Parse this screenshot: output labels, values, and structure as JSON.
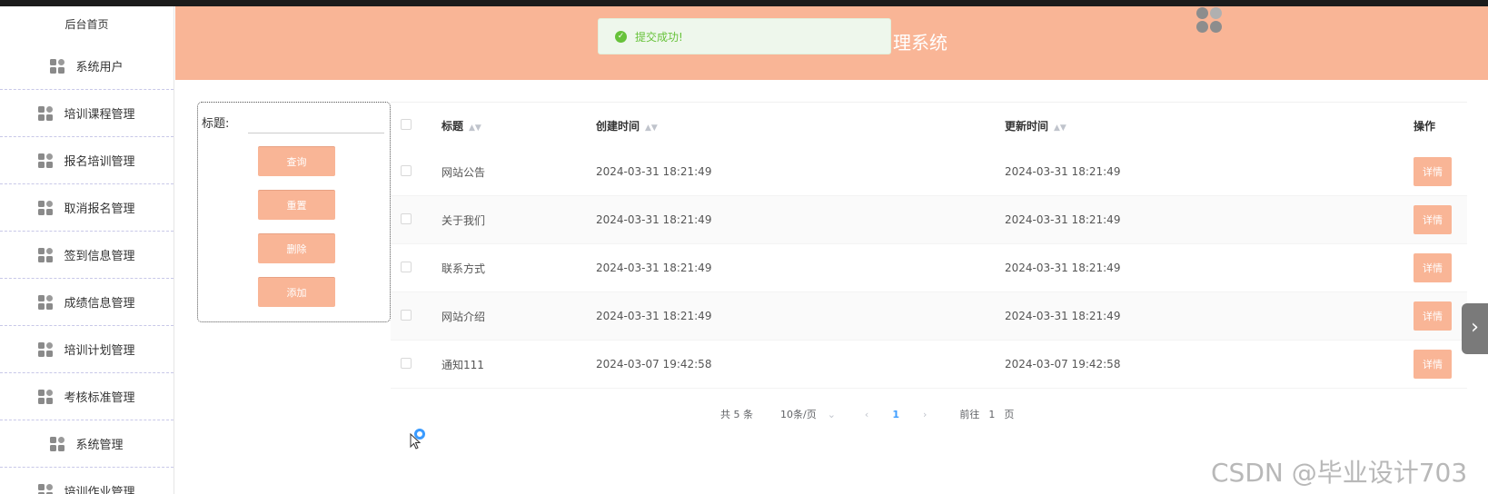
{
  "sidebar": {
    "home_label": "后台首页",
    "items": [
      {
        "label": "系统用户"
      },
      {
        "label": "培训课程管理"
      },
      {
        "label": "报名培训管理"
      },
      {
        "label": "取消报名管理"
      },
      {
        "label": "签到信息管理"
      },
      {
        "label": "成绩信息管理"
      },
      {
        "label": "培训计划管理"
      },
      {
        "label": "考核标准管理"
      },
      {
        "label": "系统管理"
      },
      {
        "label": "培训作业管理"
      }
    ]
  },
  "header": {
    "title": "理系统",
    "background_color": "#f9b596"
  },
  "toast": {
    "message": "提交成功!",
    "color": "#67c23a"
  },
  "search": {
    "title_label": "标题:",
    "title_value": "",
    "buttons": {
      "query": "查询",
      "reset": "重置",
      "delete": "删除",
      "add": "添加"
    }
  },
  "table": {
    "columns": {
      "title": "标题",
      "created": "创建时间",
      "updated": "更新时间",
      "operation": "操作"
    },
    "detail_label": "详情",
    "rows": [
      {
        "title": "网站公告",
        "created": "2024-03-31 18:21:49",
        "updated": "2024-03-31 18:21:49"
      },
      {
        "title": "关于我们",
        "created": "2024-03-31 18:21:49",
        "updated": "2024-03-31 18:21:49"
      },
      {
        "title": "联系方式",
        "created": "2024-03-31 18:21:49",
        "updated": "2024-03-31 18:21:49"
      },
      {
        "title": "网站介绍",
        "created": "2024-03-31 18:21:49",
        "updated": "2024-03-31 18:21:49"
      },
      {
        "title": "通知111",
        "created": "2024-03-07 19:42:58",
        "updated": "2024-03-07 19:42:58"
      }
    ]
  },
  "pagination": {
    "total": "共 5 条",
    "page_size": "10条/页",
    "current_page": "1",
    "goto_label": "前往",
    "goto_value": "1",
    "page_suffix": "页"
  },
  "watermark": "CSDN @毕业设计703"
}
